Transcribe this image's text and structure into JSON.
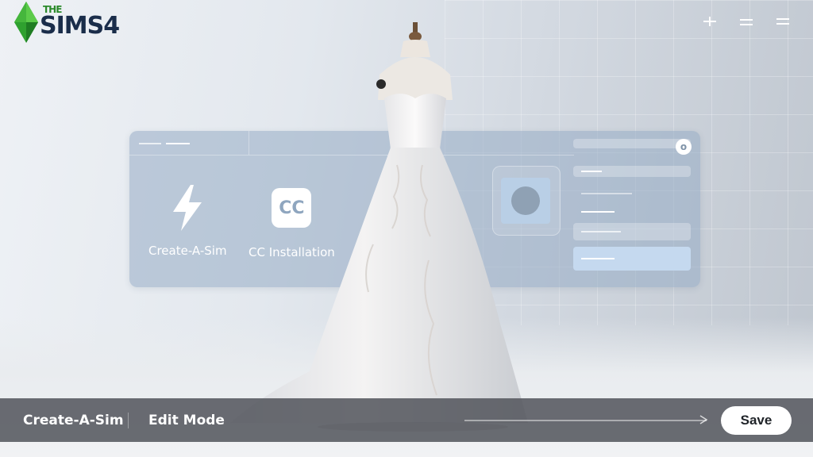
{
  "logo": {
    "the": "THE",
    "name": "SIMS4"
  },
  "header_icons": [
    "plus-icon",
    "minimize-icon",
    "menu-icon"
  ],
  "panel": {
    "tiles": [
      {
        "label": "Create-A-Sim",
        "icon": "lightning-icon"
      },
      {
        "label": "CC Installation",
        "badge": "CC"
      }
    ],
    "close_glyph": "o"
  },
  "bottom_bar": {
    "left_item": "Create-A-Sim",
    "right_item": "Edit Mode",
    "save_label": "Save"
  },
  "colors": {
    "panel": "#96acc4",
    "bar": "#55585e",
    "plumbob": "#2fa12f"
  }
}
